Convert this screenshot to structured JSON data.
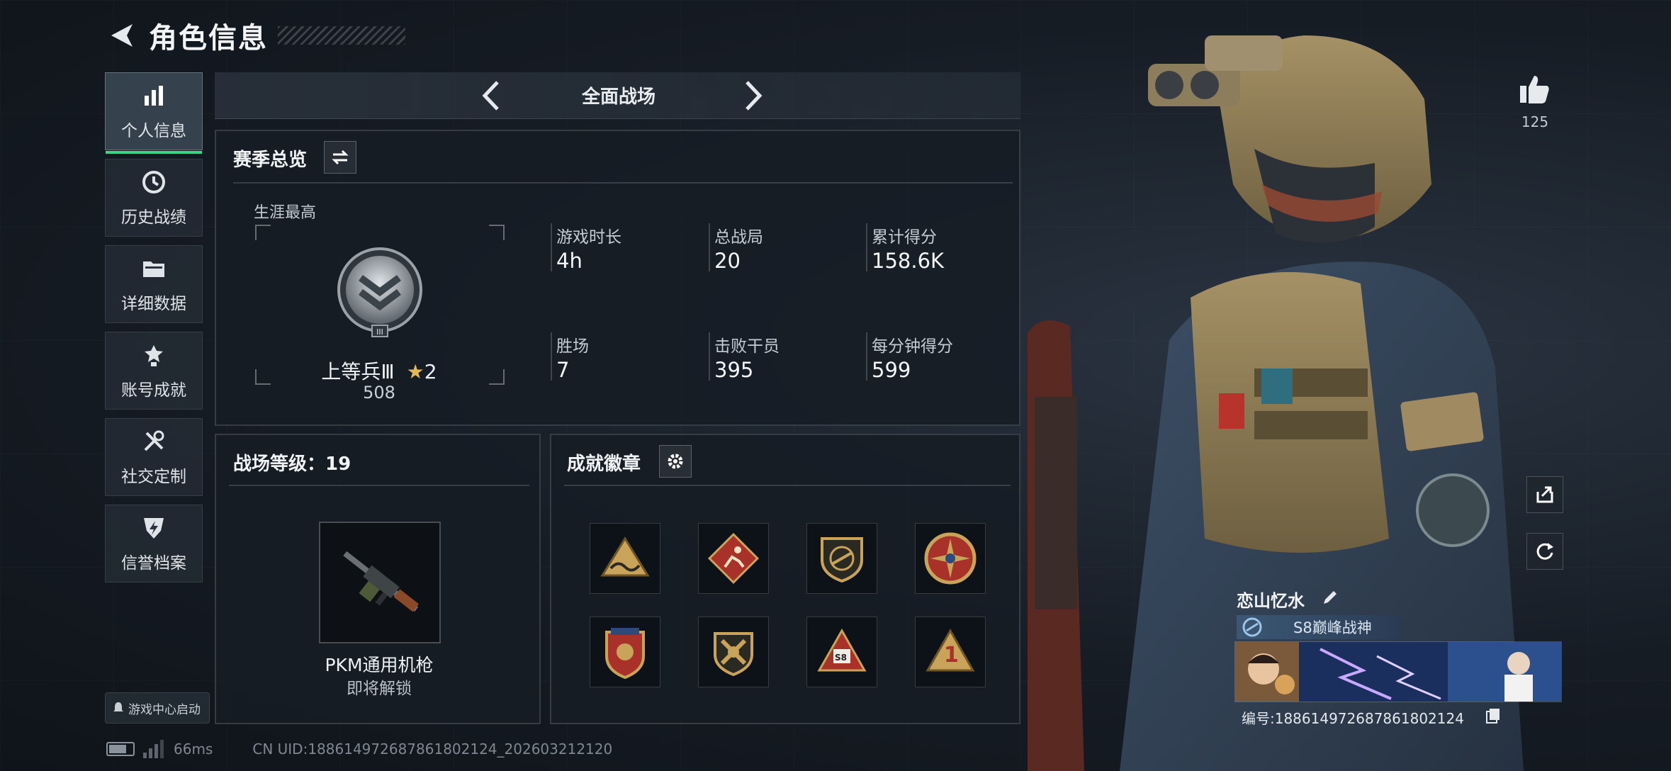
{
  "header": {
    "title": "角色信息"
  },
  "nav": [
    {
      "label": "个人信息",
      "icon": "bar-chart-icon",
      "active": true
    },
    {
      "label": "历史战绩",
      "icon": "history-clock-icon",
      "active": false
    },
    {
      "label": "详细数据",
      "icon": "folder-icon",
      "active": false
    },
    {
      "label": "账号成就",
      "icon": "medal-icon",
      "active": false
    },
    {
      "label": "社交定制",
      "icon": "tools-icon",
      "active": false
    },
    {
      "label": "信誉档案",
      "icon": "shield-lightning-icon",
      "active": false
    }
  ],
  "game_center": {
    "label": "游戏中心启动"
  },
  "mode": {
    "name": "全面战场"
  },
  "season": {
    "title": "赛季总览",
    "career_label": "生涯最高",
    "rank_name": "上等兵Ⅲ",
    "rank_stars": "2",
    "rank_score": "508",
    "stats": [
      {
        "label": "游戏时长",
        "value": "4h"
      },
      {
        "label": "总战局",
        "value": "20"
      },
      {
        "label": "累计得分",
        "value": "158.6K"
      },
      {
        "label": "胜场",
        "value": "7"
      },
      {
        "label": "击败干员",
        "value": "395"
      },
      {
        "label": "每分钟得分",
        "value": "599"
      }
    ]
  },
  "level": {
    "title": "战场等级：19",
    "weapon_name": "PKM通用机枪",
    "weapon_status": "即将解锁"
  },
  "badges": {
    "title": "成就徽章",
    "items": [
      "triangle-wave-badge",
      "runner-badge",
      "rifle-shield-badge",
      "star-compass-badge",
      "crest-badge",
      "crossed-wrench-badge",
      "s8-triangle-badge",
      "number-1-badge"
    ],
    "s8_text": "S8",
    "one_text": "1"
  },
  "player": {
    "name": "恋山忆水",
    "title": "S8巅峰战神",
    "id": "编号:188614972687861802124",
    "likes": "125"
  },
  "status": {
    "ping": "66ms",
    "uid": "CN UID:188614972687861802124_202603212120"
  },
  "colors": {
    "accent": "#3fd48c",
    "gold": "#c9a35a",
    "badge_red": "#a8322a"
  }
}
